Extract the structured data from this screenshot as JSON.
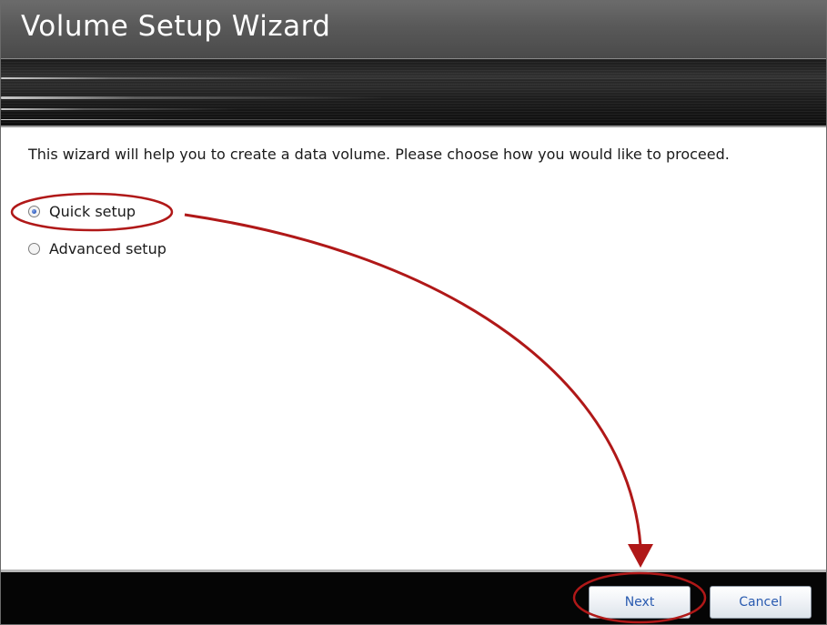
{
  "window": {
    "title": "Volume Setup Wizard"
  },
  "content": {
    "intro_text": "This wizard will help you to create a data volume. Please choose how you would like to proceed.",
    "options": [
      {
        "label": "Quick setup",
        "selected": true
      },
      {
        "label": "Advanced setup",
        "selected": false
      }
    ]
  },
  "footer": {
    "next_label": "Next",
    "cancel_label": "Cancel"
  },
  "annotations": {
    "highlight_color": "#b01818",
    "arrow_color": "#b01818"
  }
}
